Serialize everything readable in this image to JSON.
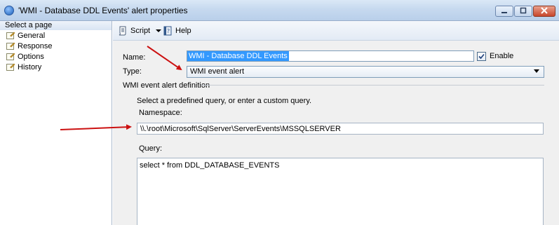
{
  "window": {
    "title": "'WMI - Database DDL Events' alert properties",
    "controls": [
      "minimize-icon",
      "maximize-icon",
      "close-icon"
    ]
  },
  "left_pane": {
    "header": "Select a page",
    "items": [
      {
        "label": "General",
        "icon": "wrench-page-icon"
      },
      {
        "label": "Response",
        "icon": "wrench-page-icon"
      },
      {
        "label": "Options",
        "icon": "wrench-page-icon"
      },
      {
        "label": "History",
        "icon": "wrench-page-icon"
      }
    ]
  },
  "toolbar": {
    "script_label": "Script",
    "help_label": "Help"
  },
  "form": {
    "name_label": "Name:",
    "name_value": "WMI - Database DDL Events",
    "enable_label": "Enable",
    "enable_checked": true,
    "type_label": "Type:",
    "type_value": "WMI event alert",
    "section_title": "WMI event alert definition",
    "instruction": "Select a predefined query, or enter a custom query.",
    "namespace_label": "Namespace:",
    "namespace_value": "\\\\.\\root\\Microsoft\\SqlServer\\ServerEvents\\MSSQLSERVER",
    "query_label": "Query:",
    "query_value": "select * from DDL_DATABASE_EVENTS"
  },
  "annotations": {
    "arrow_color": "#cc1111"
  }
}
